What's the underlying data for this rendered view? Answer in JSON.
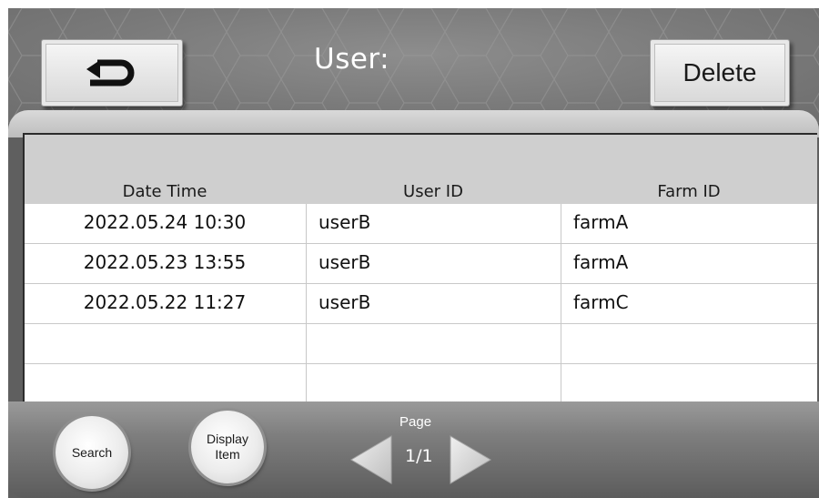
{
  "header": {
    "title": "User:",
    "back_icon": "return-arrow-icon",
    "delete_label": "Delete"
  },
  "table": {
    "columns": [
      "Date Time",
      "User ID",
      "Farm ID"
    ],
    "rows": [
      [
        "2022.05.24 10:30",
        "userB",
        "farmA"
      ],
      [
        "2022.05.23 13:55",
        "userB",
        "farmA"
      ],
      [
        "2022.05.22 11:27",
        "userB",
        "farmC"
      ],
      [
        "",
        "",
        ""
      ],
      [
        "",
        "",
        ""
      ]
    ]
  },
  "footer": {
    "search_label": "Search",
    "display_item_label_line1": "Display",
    "display_item_label_line2": "Item",
    "page_label": "Page",
    "page_number": "1/1",
    "prev_icon": "triangle-left-icon",
    "next_icon": "triangle-right-icon"
  },
  "colors": {
    "background": "#5f5f5f",
    "header_gray": "#7a7a7a",
    "table_header": "#cfcfcf",
    "button_face": "#e8e8e8",
    "arrow_fill": "#d8d8d8"
  }
}
